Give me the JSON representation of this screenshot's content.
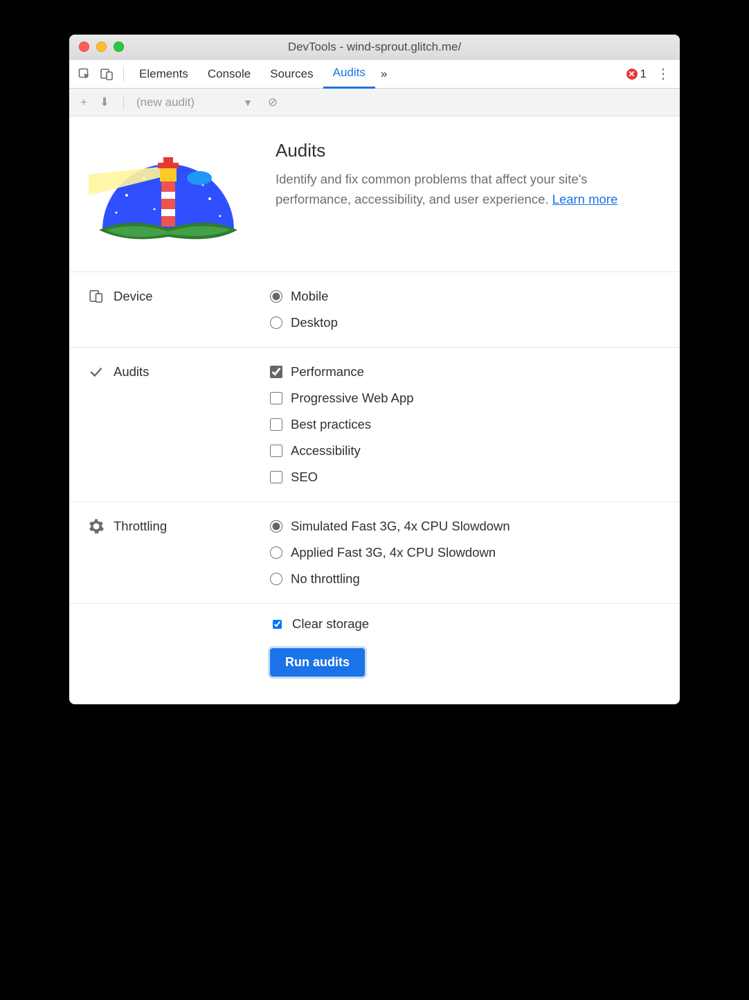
{
  "window": {
    "title": "DevTools - wind-sprout.glitch.me/"
  },
  "tabs": {
    "items": [
      "Elements",
      "Console",
      "Sources",
      "Audits"
    ],
    "active_index": 3,
    "overflow_glyph": "»",
    "error_count": "1"
  },
  "toolbar": {
    "plus_glyph": "+",
    "download_glyph": "⬇",
    "select_label": "(new audit)",
    "caret_glyph": "▼",
    "clear_glyph": "⊘"
  },
  "header": {
    "title": "Audits",
    "description": "Identify and fix common problems that affect your site's performance, accessibility, and user experience. ",
    "learn_more": "Learn more"
  },
  "sections": {
    "device": {
      "label": "Device",
      "options": [
        {
          "label": "Mobile",
          "checked": true
        },
        {
          "label": "Desktop",
          "checked": false
        }
      ]
    },
    "audits": {
      "label": "Audits",
      "options": [
        {
          "label": "Performance",
          "checked": true
        },
        {
          "label": "Progressive Web App",
          "checked": false
        },
        {
          "label": "Best practices",
          "checked": false
        },
        {
          "label": "Accessibility",
          "checked": false
        },
        {
          "label": "SEO",
          "checked": false
        }
      ]
    },
    "throttling": {
      "label": "Throttling",
      "options": [
        {
          "label": "Simulated Fast 3G, 4x CPU Slowdown",
          "checked": true
        },
        {
          "label": "Applied Fast 3G, 4x CPU Slowdown",
          "checked": false
        },
        {
          "label": "No throttling",
          "checked": false
        }
      ]
    }
  },
  "footer": {
    "clear_storage_label": "Clear storage",
    "clear_storage_checked": true,
    "run_label": "Run audits"
  }
}
